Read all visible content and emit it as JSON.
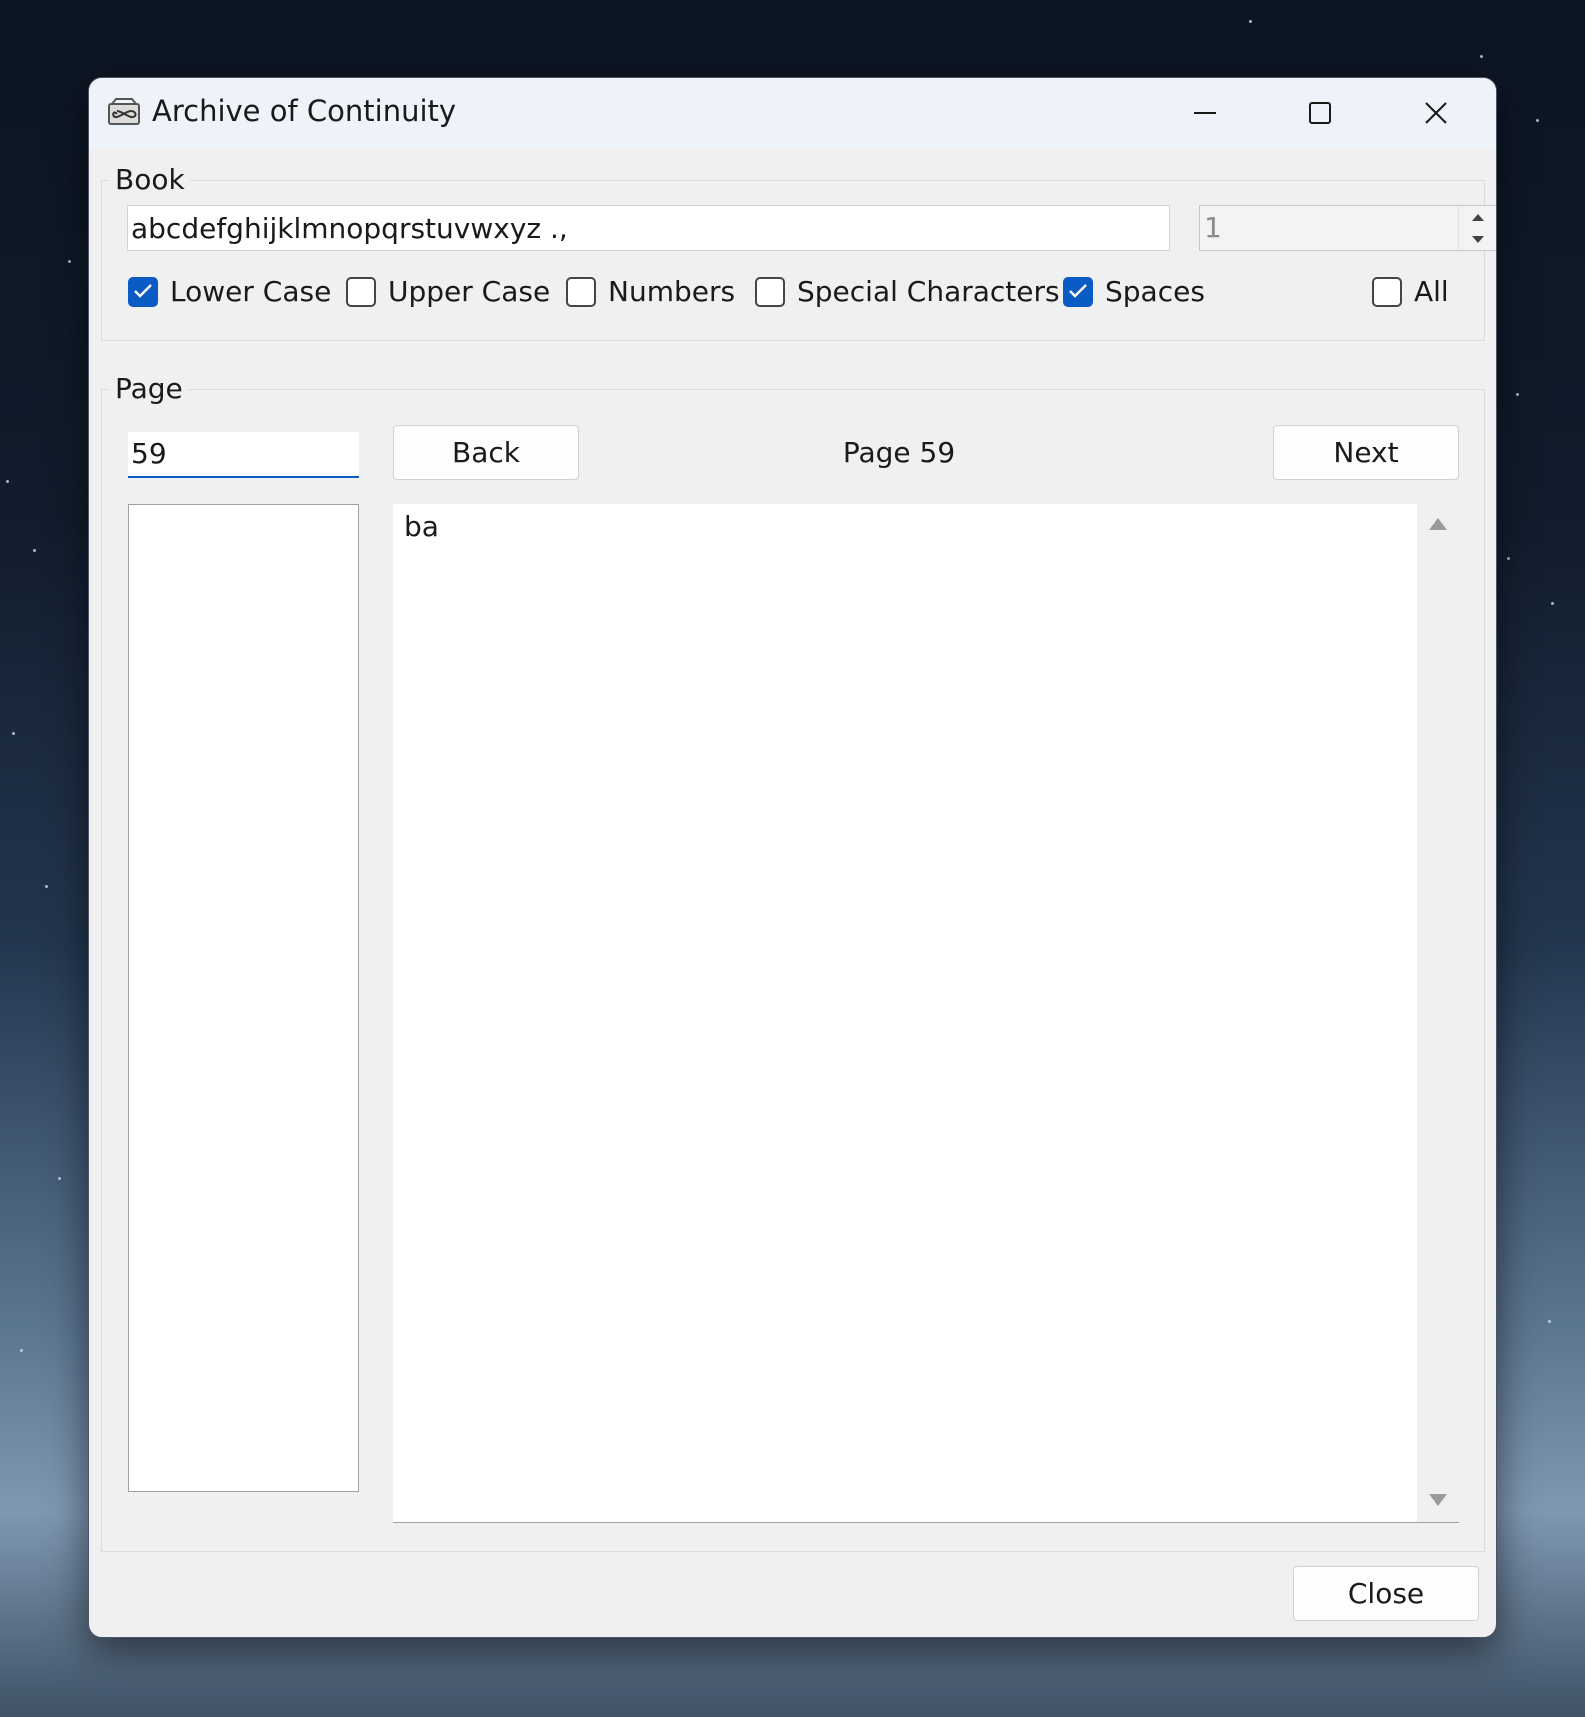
{
  "window": {
    "title": "Archive of Continuity",
    "app_icon": "infinity-book-icon",
    "controls": {
      "minimize_icon": "minimize-icon",
      "maximize_icon": "maximize-icon",
      "close_icon": "close-icon"
    }
  },
  "book": {
    "group_label": "Book",
    "charset_value": "abcdefghijklmnopqrstuvwxyz .,",
    "number_value": "1",
    "options": [
      {
        "label": "Lower Case",
        "checked": true
      },
      {
        "label": "Upper Case",
        "checked": false
      },
      {
        "label": "Numbers",
        "checked": false
      },
      {
        "label": "Special Characters",
        "checked": false
      },
      {
        "label": "Spaces",
        "checked": true
      },
      {
        "label": "All",
        "checked": false
      }
    ]
  },
  "page": {
    "group_label": "Page",
    "page_input_value": "59",
    "back_label": "Back",
    "page_display": "Page 59",
    "next_label": "Next",
    "content": "ba"
  },
  "footer": {
    "close_label": "Close"
  },
  "colors": {
    "accent": "#0b5bc4",
    "window_bg": "#f0f0f0",
    "titlebar_bg": "#eef2f9"
  }
}
